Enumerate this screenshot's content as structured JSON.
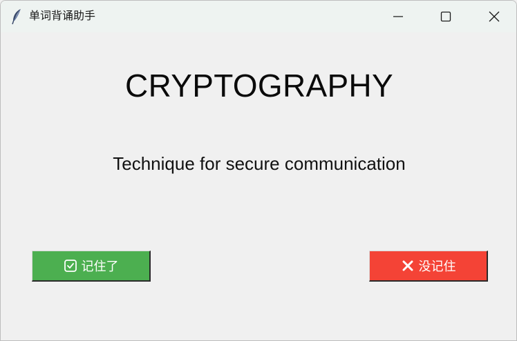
{
  "window": {
    "title": "单词背诵助手"
  },
  "card": {
    "word": "CRYPTOGRAPHY",
    "definition": "Technique for secure communication"
  },
  "actions": {
    "remembered_label": "记住了",
    "remembered_icon": "checkbox-checked-icon",
    "forgot_label": "没记住",
    "forgot_icon": "x-mark-icon"
  },
  "colors": {
    "remembered": "#4caf50",
    "forgot": "#f44336",
    "background": "#f0f0f0"
  }
}
